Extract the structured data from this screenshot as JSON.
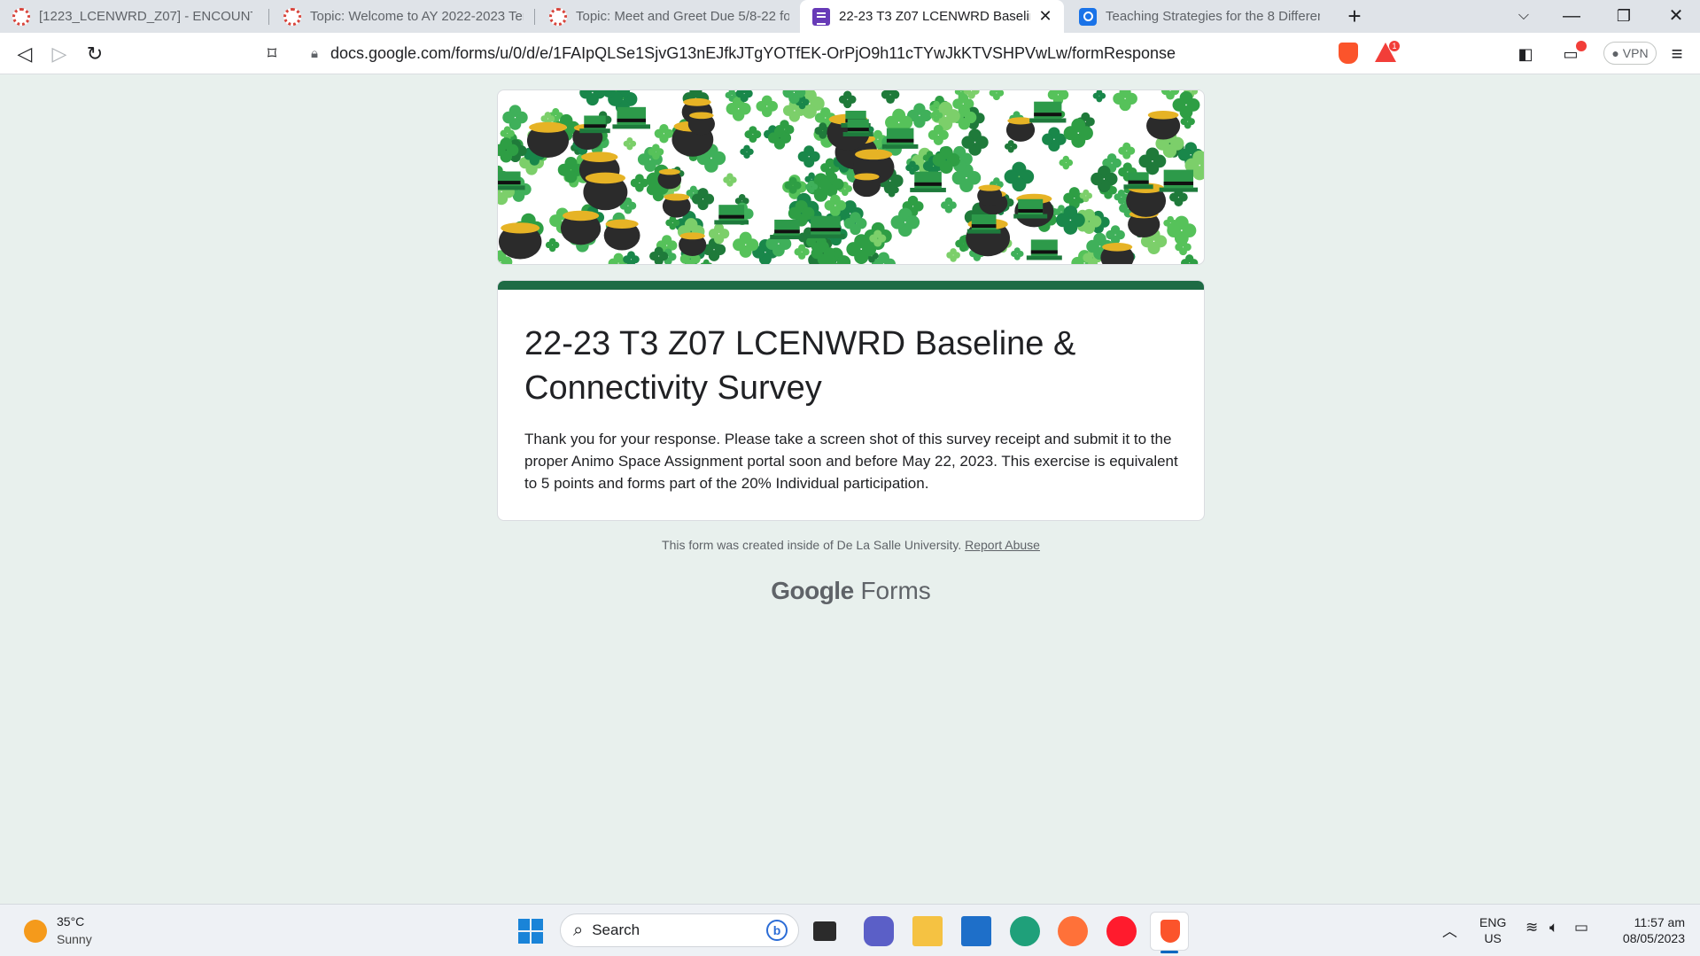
{
  "browser": {
    "tabs": [
      {
        "title": "[1223_LCENWRD_Z07] - ENCOUNTERI",
        "favicon": "dlsu-icon",
        "active": false
      },
      {
        "title": "Topic: Welcome to AY 2022-2023 Term",
        "favicon": "dlsu-icon",
        "active": false
      },
      {
        "title": "Topic: Meet and Greet Due 5/8-22 for",
        "favicon": "dlsu-icon",
        "active": false
      },
      {
        "title": "22-23 T3 Z07 LCENWRD Baseline",
        "favicon": "google-forms-icon",
        "active": true
      },
      {
        "title": "Teaching Strategies for the 8 Different",
        "favicon": "quizlet-icon",
        "active": false
      }
    ],
    "new_tab_label": "+",
    "url": "docs.google.com/forms/u/0/d/e/1FAIpQLSe1SjvG13nEJfkJTgYOTfEK-OrPjO9h11cTYwJkKTVSHPVwLw/formResponse",
    "rewards_badge": "1",
    "vpn_label": "VPN"
  },
  "form": {
    "title": "22-23 T3 Z07 LCENWRD Baseline & Connectivity Survey",
    "confirmation_message": "Thank you for your response. Please take a screen shot of this survey receipt and submit it to the proper Animo Space Assignment portal soon and before May 22, 2023.  This exercise is equivalent to 5 points and forms part of the 20% Individual participation.",
    "theme_color": "#1e6b45",
    "background_color": "#e8f0ed",
    "footer_text": "This form was created inside of De La Salle University.",
    "report_abuse_label": "Report Abuse",
    "logo_google": "Google",
    "logo_forms": "Forms"
  },
  "taskbar": {
    "weather_temp": "35°C",
    "weather_condition": "Sunny",
    "search_placeholder": "Search",
    "language_line1": "ENG",
    "language_line2": "US",
    "time": "11:57 am",
    "date": "08/05/2023"
  }
}
